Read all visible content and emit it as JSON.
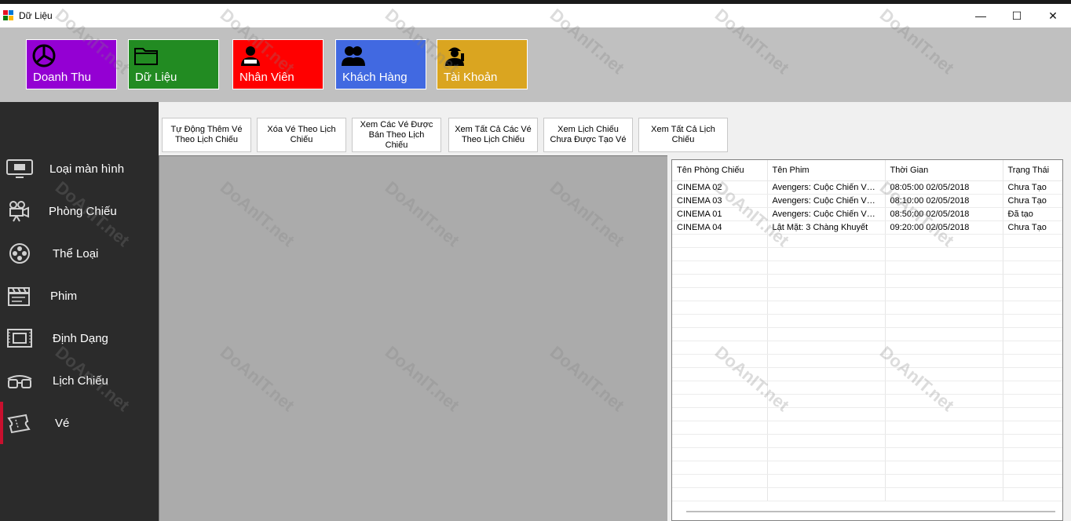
{
  "window": {
    "title": "Dữ Liệu",
    "controls": {
      "minimize": "—",
      "maximize": "☐",
      "close": "✕"
    }
  },
  "banner_tiles": [
    {
      "label": "Doanh Thu",
      "color": "#9400d3",
      "icon": "chart-pie-icon"
    },
    {
      "label": "Dữ Liệu",
      "color": "#228b22",
      "icon": "folder-icon"
    },
    {
      "label": "Nhân Viên",
      "color": "#ff0000",
      "icon": "employee-icon"
    },
    {
      "label": "Khách Hàng",
      "color": "#4169e1",
      "icon": "customers-icon"
    },
    {
      "label": "Tài Khoản",
      "color": "#daa520",
      "icon": "account-icon"
    }
  ],
  "sidebar": {
    "items": [
      {
        "label": "Loại màn hình",
        "icon": "monitor-icon"
      },
      {
        "label": "Phòng Chiếu",
        "icon": "projector-icon"
      },
      {
        "label": "Thể Loại",
        "icon": "film-reel-icon"
      },
      {
        "label": "Phim",
        "icon": "clapperboard-icon"
      },
      {
        "label": "Định Dạng",
        "icon": "format-icon"
      },
      {
        "label": "Lịch Chiếu",
        "icon": "3d-glasses-icon"
      },
      {
        "label": "Vé",
        "icon": "ticket-icon"
      }
    ],
    "active": "Vé"
  },
  "toolbar": {
    "buttons": [
      "Tự Động Thêm Vé Theo Lịch Chiếu",
      "Xóa Vé Theo Lịch Chiếu",
      "Xem Các Vé Được Bán Theo Lịch Chiếu",
      "Xem Tất Cả Các Vé Theo Lịch Chiếu",
      "Xem Lịch Chiếu Chưa Được Tạo Vé",
      "Xem Tất Cả Lịch Chiếu"
    ]
  },
  "grid": {
    "columns": [
      "Tên Phòng Chiếu",
      "Tên Phim",
      "Thời Gian",
      "Trạng Thái"
    ],
    "rows": [
      [
        "CINEMA 02",
        "Avengers: Cuộc Chiến Vô Cực",
        "08:05:00 02/05/2018",
        "Chưa Tạo"
      ],
      [
        "CINEMA 03",
        "Avengers: Cuộc Chiến Vô Cực",
        "08:10:00 02/05/2018",
        "Chưa Tạo"
      ],
      [
        "CINEMA 01",
        "Avengers: Cuộc Chiến Vô Cực",
        "08:50:00 02/05/2018",
        "Đã tạo"
      ],
      [
        "CINEMA 04",
        "Lật Mặt: 3 Chàng Khuyết",
        "09:20:00 02/05/2018",
        "Chưa Tạo"
      ]
    ]
  },
  "watermark": "DoAnIT.net"
}
